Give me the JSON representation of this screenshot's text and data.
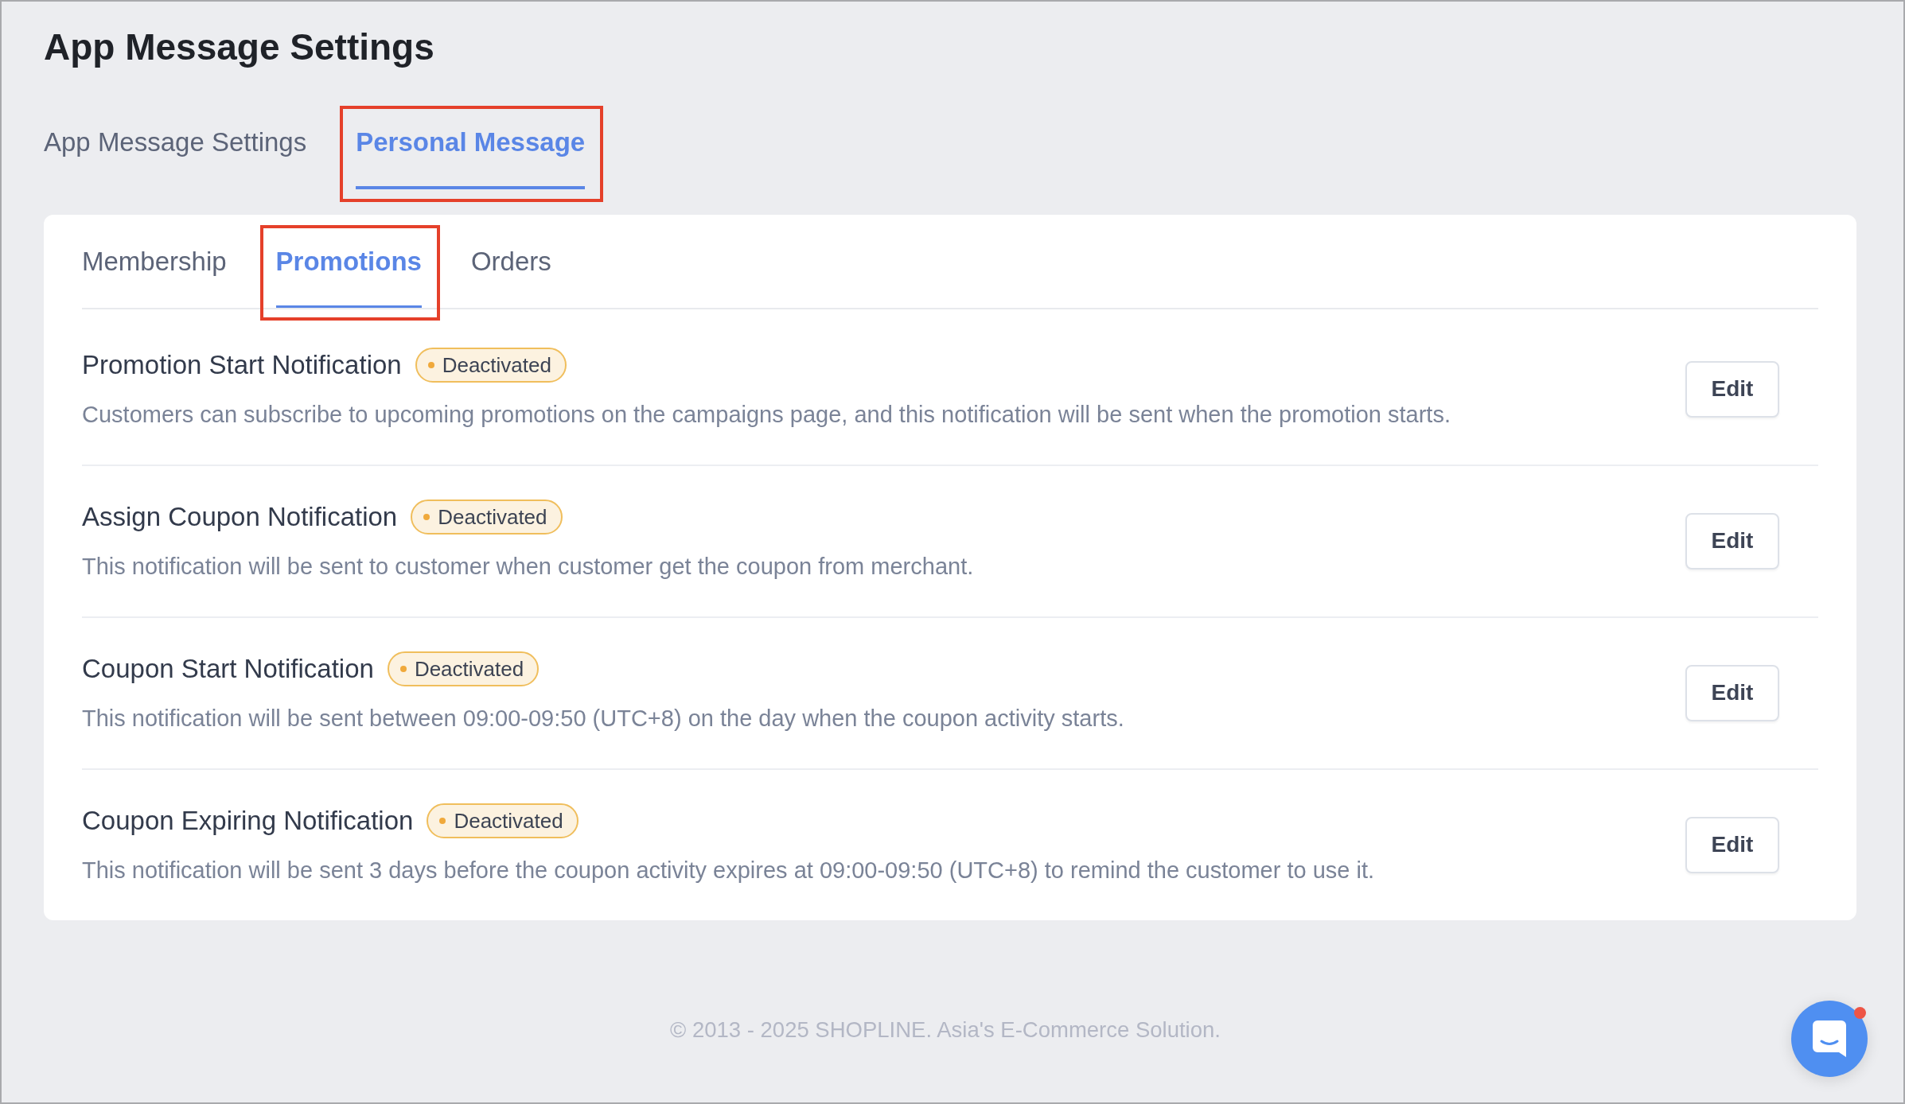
{
  "page": {
    "title": "App Message Settings"
  },
  "tabs": [
    {
      "label": "App Message Settings",
      "selected": false,
      "highlighted": false
    },
    {
      "label": "Personal Message",
      "selected": true,
      "highlighted": true
    }
  ],
  "panel": {
    "tabs": [
      {
        "label": "Membership",
        "selected": false,
        "highlighted": false
      },
      {
        "label": "Promotions",
        "selected": true,
        "highlighted": true
      },
      {
        "label": "Orders",
        "selected": false,
        "highlighted": false
      }
    ],
    "notifications": [
      {
        "title": "Promotion Start Notification",
        "status": {
          "label": "Deactivated",
          "kind": "inactive"
        },
        "description": "Customers can subscribe to upcoming promotions on the campaigns page, and this notification will be sent when the promotion starts.",
        "action": "Edit"
      },
      {
        "title": "Assign Coupon Notification",
        "status": {
          "label": "Deactivated",
          "kind": "inactive"
        },
        "description": "This notification will be sent to customer when customer get the coupon from merchant.",
        "action": "Edit"
      },
      {
        "title": "Coupon Start Notification",
        "status": {
          "label": "Deactivated",
          "kind": "inactive"
        },
        "description": "This notification will be sent between 09:00-09:50 (UTC+8) on the day when the coupon activity starts.",
        "action": "Edit"
      },
      {
        "title": "Coupon Expiring Notification",
        "status": {
          "label": "Deactivated",
          "kind": "inactive"
        },
        "description": "This notification will be sent 3 days before the coupon activity expires at 09:00-09:50 (UTC+8) to remind the customer to use it.",
        "action": "Edit"
      }
    ]
  },
  "footer": {
    "text": "© 2013 - 2025 SHOPLINE. Asia's E-Commerce Solution."
  },
  "chat_button": {
    "unread": true
  }
}
